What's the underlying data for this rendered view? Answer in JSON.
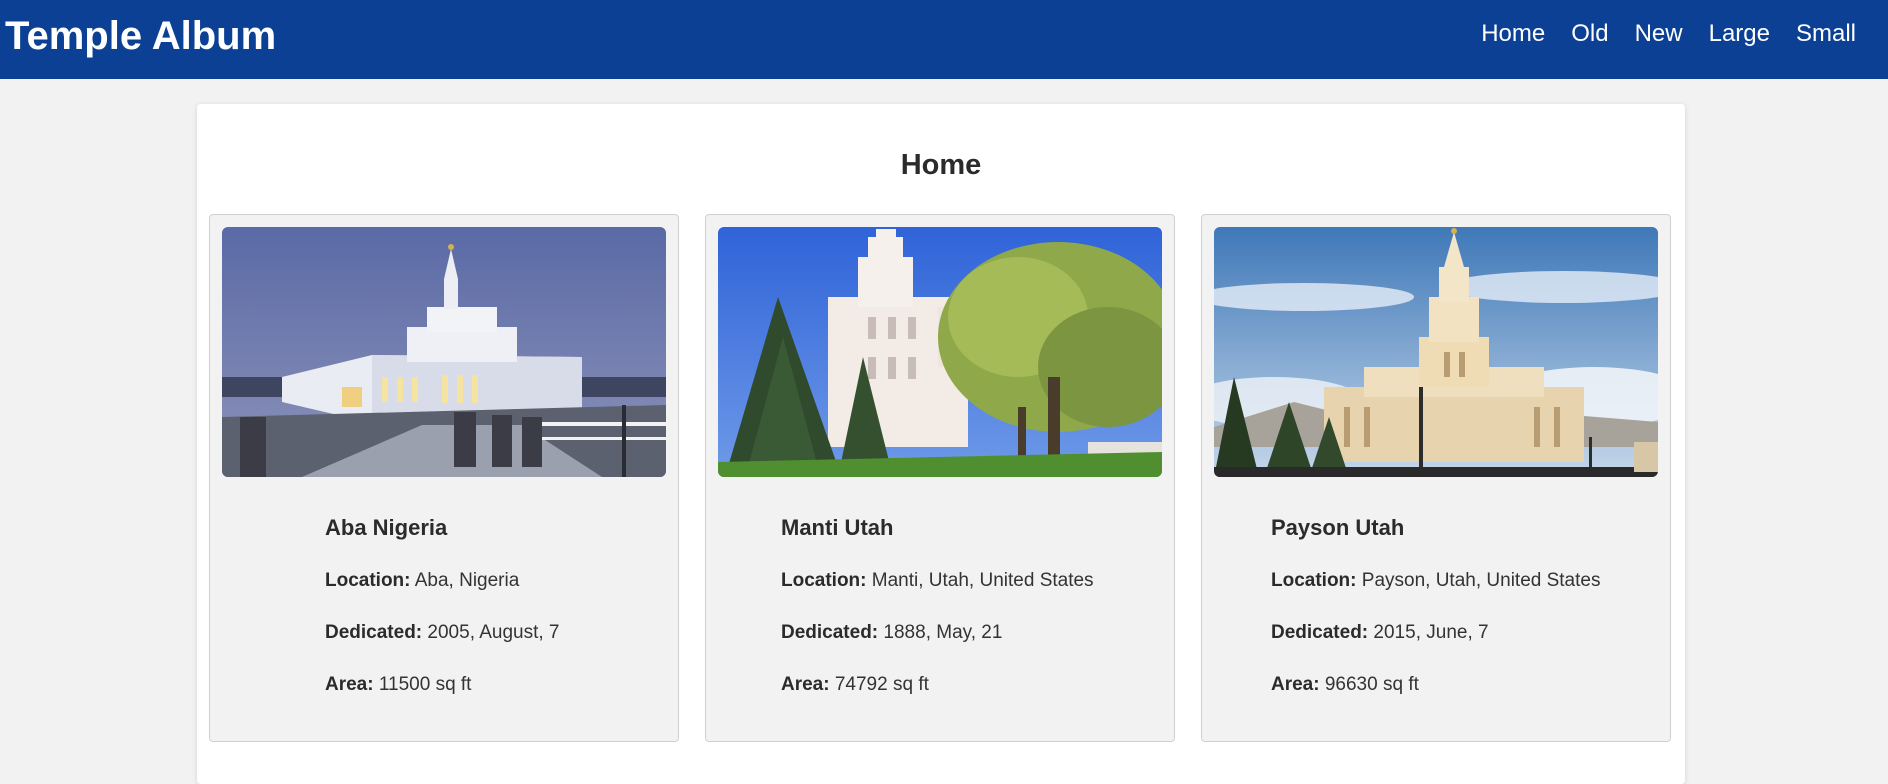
{
  "header": {
    "title": "Temple Album",
    "nav": [
      "Home",
      "Old",
      "New",
      "Large",
      "Small"
    ]
  },
  "main": {
    "title": "Home",
    "labels": {
      "location": "Location:",
      "dedicated": "Dedicated:",
      "area": "Area:"
    },
    "temples": [
      {
        "name": "Aba Nigeria",
        "location": "Aba, Nigeria",
        "dedicated": "2005, August, 7",
        "area": "11500 sq ft"
      },
      {
        "name": "Manti Utah",
        "location": "Manti, Utah, United States",
        "dedicated": "1888, May, 21",
        "area": "74792 sq ft"
      },
      {
        "name": "Payson Utah",
        "location": "Payson, Utah, United States",
        "dedicated": "2015, June, 7",
        "area": "96630 sq ft"
      }
    ]
  },
  "colors": {
    "header_bg": "#0b4095",
    "page_bg": "#f2f2f2",
    "card_bg": "#f2f2f2",
    "text": "#333333"
  }
}
